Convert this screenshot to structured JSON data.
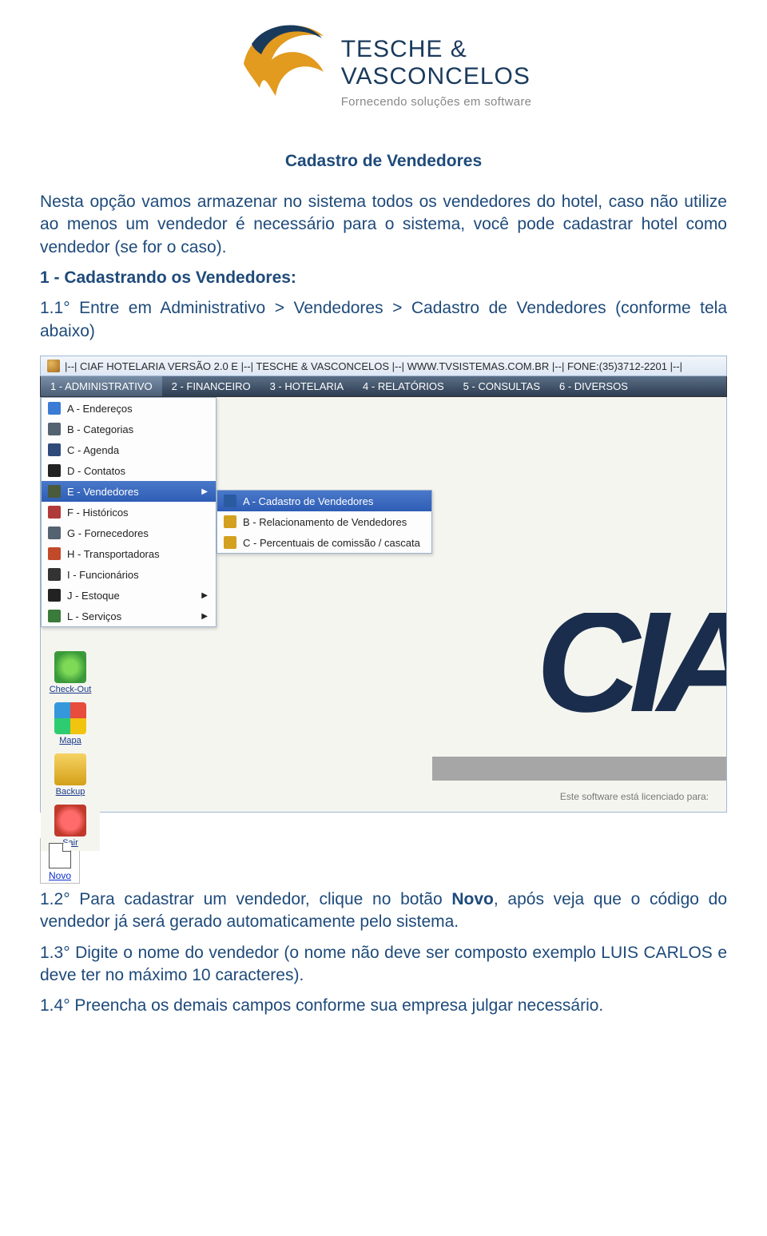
{
  "logo": {
    "line1": "TESCHE &",
    "line2": "VASCONCELOS",
    "tagline": "Fornecendo soluções em software"
  },
  "doc": {
    "title": "Cadastro de Vendedores",
    "intro": "Nesta opção vamos armazenar no sistema todos os vendedores do hotel, caso não utilize ao menos um vendedor é necessário para o sistema, você pode cadastrar hotel como vendedor (se for o caso).",
    "section1_heading": "1 - Cadastrando os Vendedores:",
    "step1_1": "1.1° Entre em Administrativo > Vendedores > Cadastro de Vendedores (conforme tela abaixo)",
    "step1_2_a": "1.2° Para cadastrar um vendedor, clique no botão ",
    "step1_2_bold": "Novo",
    "step1_2_b": ", após veja que o código do vendedor já será gerado automaticamente pelo sistema.",
    "step1_3": "1.3° Digite o nome do vendedor (o nome não deve ser composto exemplo LUIS CARLOS e deve ter no máximo 10 caracteres).",
    "step1_4": "1.4° Preencha os demais campos conforme sua empresa julgar necessário."
  },
  "screenshot": {
    "titlebar": "|--| CIAF HOTELARIA VERSÃO 2.0 E |--| TESCHE & VASCONCELOS |--| WWW.TVSISTEMAS.COM.BR |--| FONE:(35)3712-2201 |--|",
    "menus": [
      "1 - ADMINISTRATIVO",
      "2 - FINANCEIRO",
      "3 - HOTELARIA",
      "4 - RELATÓRIOS",
      "5 - CONSULTAS",
      "6 - DIVERSOS"
    ],
    "admin_menu": [
      {
        "label": "A - Endereços",
        "icon": "#3a7bd5"
      },
      {
        "label": "B - Categorias",
        "icon": "#556270"
      },
      {
        "label": "C - Agenda",
        "icon": "#2e4a7a"
      },
      {
        "label": "D - Contatos",
        "icon": "#222222"
      },
      {
        "label": "E - Vendedores",
        "icon": "#4a5a3a",
        "hovered": true,
        "has_sub": true
      },
      {
        "label": "F - Históricos",
        "icon": "#b03a3a"
      },
      {
        "label": "G - Fornecedores",
        "icon": "#556270"
      },
      {
        "label": "H - Transportadoras",
        "icon": "#c14a2a"
      },
      {
        "label": "I - Funcionários",
        "icon": "#333333"
      },
      {
        "label": "J - Estoque",
        "icon": "#222222",
        "has_sub": true
      },
      {
        "label": "L - Serviços",
        "icon": "#3a7a3a",
        "has_sub": true
      }
    ],
    "vendedores_sub": [
      {
        "label": "A - Cadastro de Vendedores",
        "icon": "#2a5aa0",
        "hovered": true
      },
      {
        "label": "B - Relacionamento de Vendedores",
        "icon": "#d4a020"
      },
      {
        "label": "C - Percentuais de comissão / cascata",
        "icon": "#d4a020"
      }
    ],
    "left_toolbar": [
      {
        "label": "Check-Out",
        "color": "#3a9a3a"
      },
      {
        "label": "Mapa",
        "color": "#3aa0e0"
      },
      {
        "label": "Backup",
        "color": "#e0a030"
      },
      {
        "label": "Sair",
        "color": "#d03a3a"
      }
    ],
    "toolbar_icon_styles": {
      "Check-Out": "radial-gradient(circle at 50% 50%, #7ed957 30%, #3a9a3a 70%)",
      "Mapa": "conic-gradient(#e74c3c 0 25%, #f1c40f 0 50%, #2ecc71 0 75%, #3498db 0 100%)",
      "Backup": "linear-gradient(#f6d365, #d4a017)",
      "Sair": "radial-gradient(circle at 50% 50%, #ff6b6b 40%, #c0392b 70%)"
    },
    "cia_text": "CIA",
    "license": "Este software está licenciado para:"
  },
  "novo_button": {
    "label": "Novo"
  }
}
